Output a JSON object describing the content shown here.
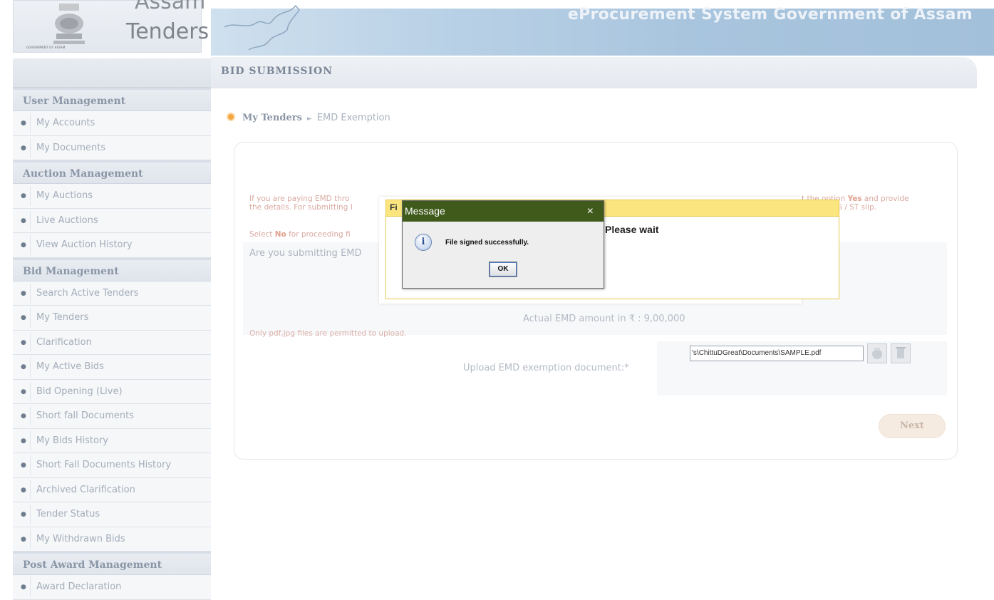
{
  "header": {
    "logo_line1": "Assam",
    "logo_line2": "Tenders",
    "emblem_caption": "GOVERNMENT OF ASSAM",
    "banner_title": "eProcurement System Government of Assam"
  },
  "sidebar": {
    "sections": [
      {
        "title": "User Management",
        "items": [
          "My Accounts",
          "My Documents"
        ]
      },
      {
        "title": "Auction Management",
        "items": [
          "My Auctions",
          "Live Auctions",
          "View Auction History"
        ]
      },
      {
        "title": "Bid Management",
        "items": [
          "Search Active Tenders",
          "My Tenders",
          "Clarification",
          "My Active Bids",
          "Bid Opening (Live)",
          "Short fall Documents",
          "My Bids History",
          "Short Fall Documents History",
          "Archived Clarification",
          "Tender Status",
          "My Withdrawn Bids"
        ]
      },
      {
        "title": "Post Award Management",
        "items": [
          "Award Declaration"
        ]
      }
    ]
  },
  "page": {
    "title": "BID SUBMISSION",
    "breadcrumb_link": "My Tenders",
    "breadcrumb_sep": "►",
    "breadcrumb_current": "EMD Exemption",
    "info_line1_left": "If you are paying EMD thro",
    "info_line2_left": "the details. For submitting I",
    "info_line1_right_a": "t the option ",
    "info_line1_right_b": "Yes",
    "info_line1_right_c": " and provide",
    "info_line2_right": "copy of BG / ST slip.",
    "select_no_a": "Select ",
    "select_no_b": "No",
    "select_no_c": " for proceeding fi",
    "question": "Are you submitting EMD",
    "emd_amount": "Actual EMD amount in ₹ : 9,00,000",
    "only_pdf": "Only pdf,jpg files are permitted to upload.",
    "upload_label": "Upload EMD exemption document:*",
    "file_value": "'s\\ChittuDGreat\\Documents\\SAMPLE.pdf",
    "next_label": "Next"
  },
  "wait_dialog": {
    "bar_text": "Fi",
    "message": "Please wait"
  },
  "message_dialog": {
    "title": "Message",
    "close_glyph": "×",
    "icon": "info-icon",
    "icon_glyph": "i",
    "text": "File signed successfully.",
    "ok_label": "OK"
  }
}
